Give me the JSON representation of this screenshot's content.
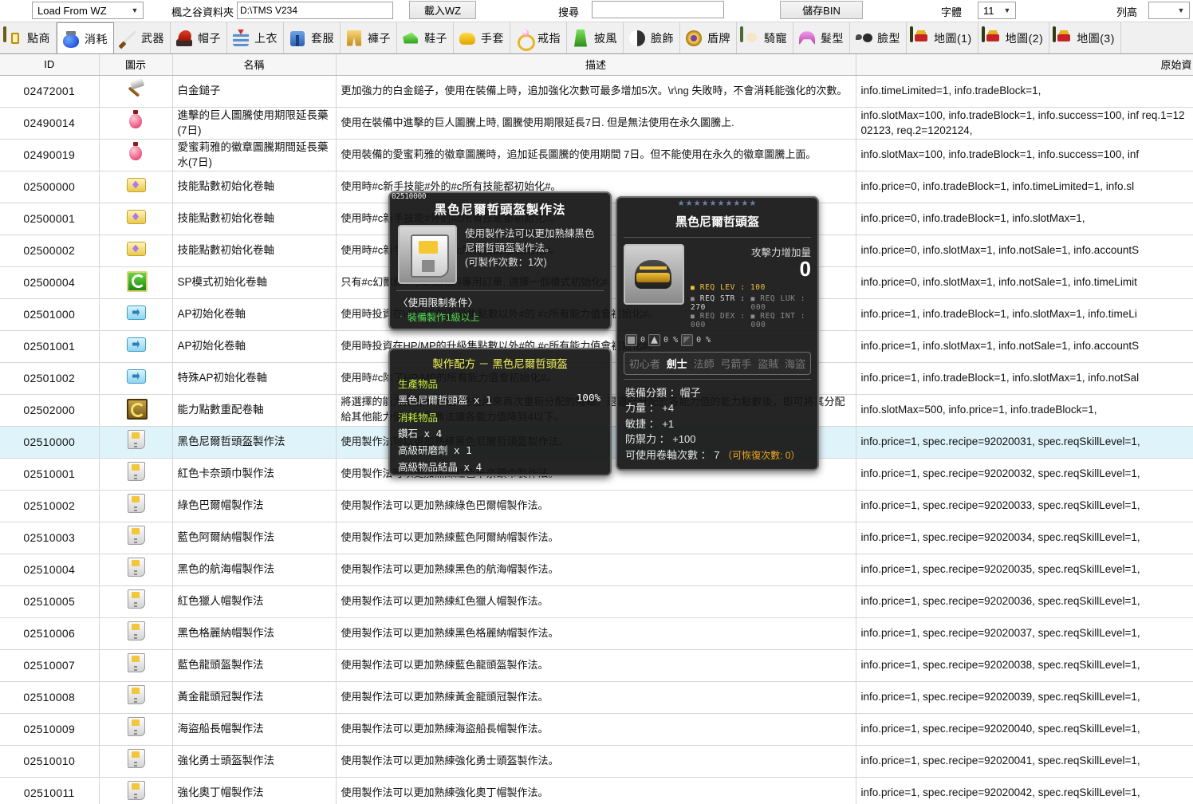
{
  "toolbar": {
    "load_mode": "Load From WZ",
    "folder_label": "楓之谷資料夾",
    "folder_path": "D:\\TMS V234",
    "load_wz_button": "載入WZ",
    "search_label": "搜尋",
    "search_value": "",
    "save_bin_button": "儲存BIN",
    "font_label": "字體",
    "font_size": "11",
    "rowheight_label": "列高",
    "rowheight_value": ""
  },
  "tabs": [
    {
      "label": "點商",
      "icon": "cash-shop-icon",
      "icon_class": "ic-cash",
      "active": false
    },
    {
      "label": "消耗",
      "icon": "potion-icon",
      "icon_class": "ic-potion",
      "active": true
    },
    {
      "label": "武器",
      "icon": "sword-icon",
      "icon_class": "ic-sword",
      "active": false
    },
    {
      "label": "帽子",
      "icon": "hat-icon",
      "icon_class": "ic-hat",
      "active": false
    },
    {
      "label": "上衣",
      "icon": "shirt-icon",
      "icon_class": "ic-top",
      "active": false
    },
    {
      "label": "套服",
      "icon": "overall-icon",
      "icon_class": "ic-overall",
      "active": false
    },
    {
      "label": "褲子",
      "icon": "pants-icon",
      "icon_class": "ic-pants",
      "active": false
    },
    {
      "label": "鞋子",
      "icon": "shoes-icon",
      "icon_class": "ic-shoes",
      "active": false
    },
    {
      "label": "手套",
      "icon": "glove-icon",
      "icon_class": "ic-glove",
      "active": false
    },
    {
      "label": "戒指",
      "icon": "ring-icon",
      "icon_class": "ic-ring",
      "active": false
    },
    {
      "label": "披風",
      "icon": "cape-icon",
      "icon_class": "ic-cape",
      "active": false
    },
    {
      "label": "臉飾",
      "icon": "face-accessory-icon",
      "icon_class": "ic-face",
      "active": false
    },
    {
      "label": "盾牌",
      "icon": "shield-icon",
      "icon_class": "ic-shield",
      "active": false
    },
    {
      "label": "騎寵",
      "icon": "mount-icon",
      "icon_class": "ic-mount",
      "active": false
    },
    {
      "label": "髮型",
      "icon": "hair-icon",
      "icon_class": "ic-hair",
      "active": false
    },
    {
      "label": "臉型",
      "icon": "eye-icon",
      "icon_class": "ic-eye",
      "active": false
    },
    {
      "label": "地圖(1)",
      "icon": "map-icon",
      "icon_class": "ic-map",
      "active": false
    },
    {
      "label": "地圖(2)",
      "icon": "map-icon",
      "icon_class": "ic-map",
      "active": false
    },
    {
      "label": "地圖(3)",
      "icon": "map-icon",
      "icon_class": "ic-map",
      "active": false
    }
  ],
  "table": {
    "columns": [
      "ID",
      "圖示",
      "名稱",
      "描述",
      "原始資"
    ],
    "rows": [
      {
        "id": "02472001",
        "icon": "hammer-icon",
        "icon_class": "ri-hammer",
        "name": "白金鎚子",
        "desc": "更加強力的白金鎚子，使用在裝備上時，追加強化次數可最多增加5次。\\r\\ng 失敗時，不會消耗能強化的次數。",
        "raw": "info.timeLimited=1,  info.tradeBlock=1,",
        "selected": false
      },
      {
        "id": "02490014",
        "icon": "potion-icon",
        "icon_class": "ri-pot",
        "name": "進擊的巨人圖騰使用期限延長藥(7日)",
        "desc": "使用在裝備中進擊的巨人圖騰上時, 圖騰使用期限延長7日. 但是無法使用在永久圖騰上.",
        "raw": "info.slotMax=100,  info.tradeBlock=1,  info.success=100,  inf\nreq.1=1202123,  req.2=1202124,",
        "selected": false
      },
      {
        "id": "02490019",
        "icon": "potion-icon",
        "icon_class": "ri-pot",
        "name": "愛蜜莉雅的徽章圖騰期間延長藥水(7日)",
        "desc": "使用裝備的愛蜜莉雅的徽章圖騰時，追加延長圖騰的使用期間 7日。但不能使用在永久的徽章圖騰上面。",
        "raw": "info.slotMax=100,  info.tradeBlock=1,  info.success=100,  inf",
        "selected": false
      },
      {
        "id": "02500000",
        "icon": "skill-scroll-icon",
        "icon_class": "ri-scroll-p",
        "name": "技能點數初始化卷軸",
        "desc": "使用時#c新手技能#外的#c所有技能都初始化#。",
        "raw": "info.price=0,  info.tradeBlock=1,  info.timeLimited=1,  info.sl",
        "selected": false
      },
      {
        "id": "02500001",
        "icon": "skill-scroll-icon",
        "icon_class": "ri-scroll-p",
        "name": "技能點數初始化卷軸",
        "desc": "使用時#c新手技能#外的#c所有技能都初始化#。",
        "raw": "info.price=0,  info.tradeBlock=1,  info.slotMax=1,",
        "selected": false
      },
      {
        "id": "02500002",
        "icon": "skill-scroll-icon",
        "icon_class": "ri-scroll-p",
        "name": "技能點數初始化卷軸",
        "desc": "使用時#c新手技能#外的#c所有技能都初始化#。",
        "raw": "info.price=0,  info.slotMax=1,  info.notSale=1,  info.accountS",
        "selected": false
      },
      {
        "id": "02500004",
        "icon": "sp-mode-icon",
        "icon_class": "ri-mode",
        "name": "SP模式初始化卷軸",
        "desc": "只有#c幻獸師#可以使用的專用訂單, 選擇一個模式初始化#。",
        "raw": "info.price=0,  info.slotMax=1,  info.notSale=1,  info.timeLimit",
        "selected": false
      },
      {
        "id": "02501000",
        "icon": "ap-scroll-icon",
        "icon_class": "ri-scroll-b",
        "name": "AP初始化卷軸",
        "desc": "使用時投資在HP/MP的升級集點數以外#的 #c所有能力值會初始化#。",
        "raw": "info.price=1,  info.tradeBlock=1,  info.slotMax=1,  info.timeLi",
        "selected": false
      },
      {
        "id": "02501001",
        "icon": "ap-scroll-icon",
        "icon_class": "ri-scroll-b",
        "name": "AP初始化卷軸",
        "desc": "使用時投資在HP/MP的升級集點數以外#的 #c所有能力值會初始化#。",
        "raw": "info.price=1,  info.slotMax=1,  info.notSale=1,  info.accountS",
        "selected": false
      },
      {
        "id": "02501002",
        "icon": "ap-scroll-icon",
        "icon_class": "ri-scroll-b",
        "name": "特殊AP初始化卷軸",
        "desc": "使用時#c除了HP/MP的所有能力值會初始化#。",
        "raw": "info.price=1,  info.tradeBlock=1,  info.slotMax=1,  info.notSal",
        "selected": false
      },
      {
        "id": "02502000",
        "icon": "ap-reset-box-icon",
        "icon_class": "ri-apbox",
        "name": "能力點數重配卷軸",
        "desc": "將選擇的能力點數#c退還1點後用來再次重新分配的捲軸。退還已分配於各能力值的能力點數後，即可將其分配給其他能力值，但是無法讓各能力值降到4以下。",
        "raw": "info.slotMax=500,  info.price=1,  info.tradeBlock=1,",
        "selected": false
      },
      {
        "id": "02510000",
        "icon": "recipe-icon",
        "icon_class": "ri-recipe",
        "name": "黑色尼爾哲頭盔製作法",
        "desc": "使用製作法可以更加熟練黑色尼爾哲頭盔製作法。",
        "raw": "info.price=1,  spec.recipe=92020031,  spec.reqSkillLevel=1,",
        "selected": true
      },
      {
        "id": "02510001",
        "icon": "recipe-icon",
        "icon_class": "ri-recipe",
        "name": "紅色卡奈頭巾製作法",
        "desc": "使用製作法可以更加熟練紅色卡奈頭巾製作法。",
        "raw": "info.price=1,  spec.recipe=92020032,  spec.reqSkillLevel=1,",
        "selected": false
      },
      {
        "id": "02510002",
        "icon": "recipe-icon",
        "icon_class": "ri-recipe",
        "name": "綠色巴爾帽製作法",
        "desc": "使用製作法可以更加熟練綠色巴爾帽製作法。",
        "raw": "info.price=1,  spec.recipe=92020033,  spec.reqSkillLevel=1,",
        "selected": false
      },
      {
        "id": "02510003",
        "icon": "recipe-icon",
        "icon_class": "ri-recipe",
        "name": "藍色阿爾納帽製作法",
        "desc": "使用製作法可以更加熟練藍色阿爾納帽製作法。",
        "raw": "info.price=1,  spec.recipe=92020034,  spec.reqSkillLevel=1,",
        "selected": false
      },
      {
        "id": "02510004",
        "icon": "recipe-icon",
        "icon_class": "ri-recipe",
        "name": "黑色的航海帽製作法",
        "desc": "使用製作法可以更加熟練黑色的航海帽製作法。",
        "raw": "info.price=1,  spec.recipe=92020035,  spec.reqSkillLevel=1,",
        "selected": false
      },
      {
        "id": "02510005",
        "icon": "recipe-icon",
        "icon_class": "ri-recipe",
        "name": "紅色獵人帽製作法",
        "desc": "使用製作法可以更加熟練紅色獵人帽製作法。",
        "raw": "info.price=1,  spec.recipe=92020036,  spec.reqSkillLevel=1,",
        "selected": false
      },
      {
        "id": "02510006",
        "icon": "recipe-icon",
        "icon_class": "ri-recipe",
        "name": "黑色格麗納帽製作法",
        "desc": "使用製作法可以更加熟練黑色格麗納帽製作法。",
        "raw": "info.price=1,  spec.recipe=92020037,  spec.reqSkillLevel=1,",
        "selected": false
      },
      {
        "id": "02510007",
        "icon": "recipe-icon",
        "icon_class": "ri-recipe",
        "name": "藍色龍頭盔製作法",
        "desc": "使用製作法可以更加熟練藍色龍頭盔製作法。",
        "raw": "info.price=1,  spec.recipe=92020038,  spec.reqSkillLevel=1,",
        "selected": false
      },
      {
        "id": "02510008",
        "icon": "recipe-icon",
        "icon_class": "ri-recipe",
        "name": "黃金龍頭冠製作法",
        "desc": "使用製作法可以更加熟練黃金龍頭冠製作法。",
        "raw": "info.price=1,  spec.recipe=92020039,  spec.reqSkillLevel=1,",
        "selected": false
      },
      {
        "id": "02510009",
        "icon": "recipe-icon",
        "icon_class": "ri-recipe",
        "name": "海盜船長帽製作法",
        "desc": "使用製作法可以更加熟練海盜船長帽製作法。",
        "raw": "info.price=1,  spec.recipe=92020040,  spec.reqSkillLevel=1,",
        "selected": false
      },
      {
        "id": "02510010",
        "icon": "recipe-icon",
        "icon_class": "ri-recipe",
        "name": "強化勇士頭盔製作法",
        "desc": "使用製作法可以更加熟練強化勇士頭盔製作法。",
        "raw": "info.price=1,  spec.recipe=92020041,  spec.reqSkillLevel=1,",
        "selected": false
      },
      {
        "id": "02510011",
        "icon": "recipe-icon",
        "icon_class": "ri-recipe",
        "name": "強化奧丁帽製作法",
        "desc": "使用製作法可以更加熟練強化奧丁帽製作法。",
        "raw": "info.price=1,  spec.recipe=92020042,  spec.reqSkillLevel=1,",
        "selected": false
      }
    ]
  },
  "recipe_tooltip": {
    "item_id": "02510000",
    "title": "黑色尼爾哲頭盔製作法",
    "description": "使用製作法可以更加熟練黑色尼爾哲頭盔製作法。",
    "craft_count": "(可製作次數：1次)",
    "condition_title": "〈使用限制条件〉",
    "condition_item": "裝備製作1級以上"
  },
  "formula_tooltip": {
    "title": "製作配方 － 黑色尼爾哲頭盔",
    "produce_label": "生產物品",
    "produce_item": "黑色尼爾哲頭盔 x 1",
    "produce_rate": "100%",
    "consume_label": "消耗物品",
    "consume_items": [
      "鑽石 x 4",
      "高級研磨劑 x 1",
      "高級物品結晶 x 4"
    ]
  },
  "item_tooltip": {
    "stars": "★★★★★★★★★★",
    "title": "黑色尼爾哲頭盔",
    "attack_label": "攻擊力增加量",
    "attack_value": "0",
    "req_lev": "REQ LEV : 100",
    "req_str": "REQ STR : 270",
    "req_luk": "REQ LUK : 000",
    "req_dex": "REQ DEX : 000",
    "req_int": "REQ INT : 000",
    "potential_1": "0",
    "potential_2": "0 %",
    "potential_3": "0 %",
    "jobs": [
      {
        "label": "初心者",
        "active": false
      },
      {
        "label": "劍士",
        "active": true
      },
      {
        "label": "法師",
        "active": false
      },
      {
        "label": "弓箭手",
        "active": false
      },
      {
        "label": "盜賊",
        "active": false
      },
      {
        "label": "海盜",
        "active": false
      }
    ],
    "stats": [
      "裝備分類 ：帽子",
      "力量 ： +4",
      "敏捷 ： +1",
      "防禦力 ： +100"
    ],
    "scroll_label": "可使用卷軸次數 ： 7",
    "scroll_recover": "（可恢復次數: 0）"
  }
}
